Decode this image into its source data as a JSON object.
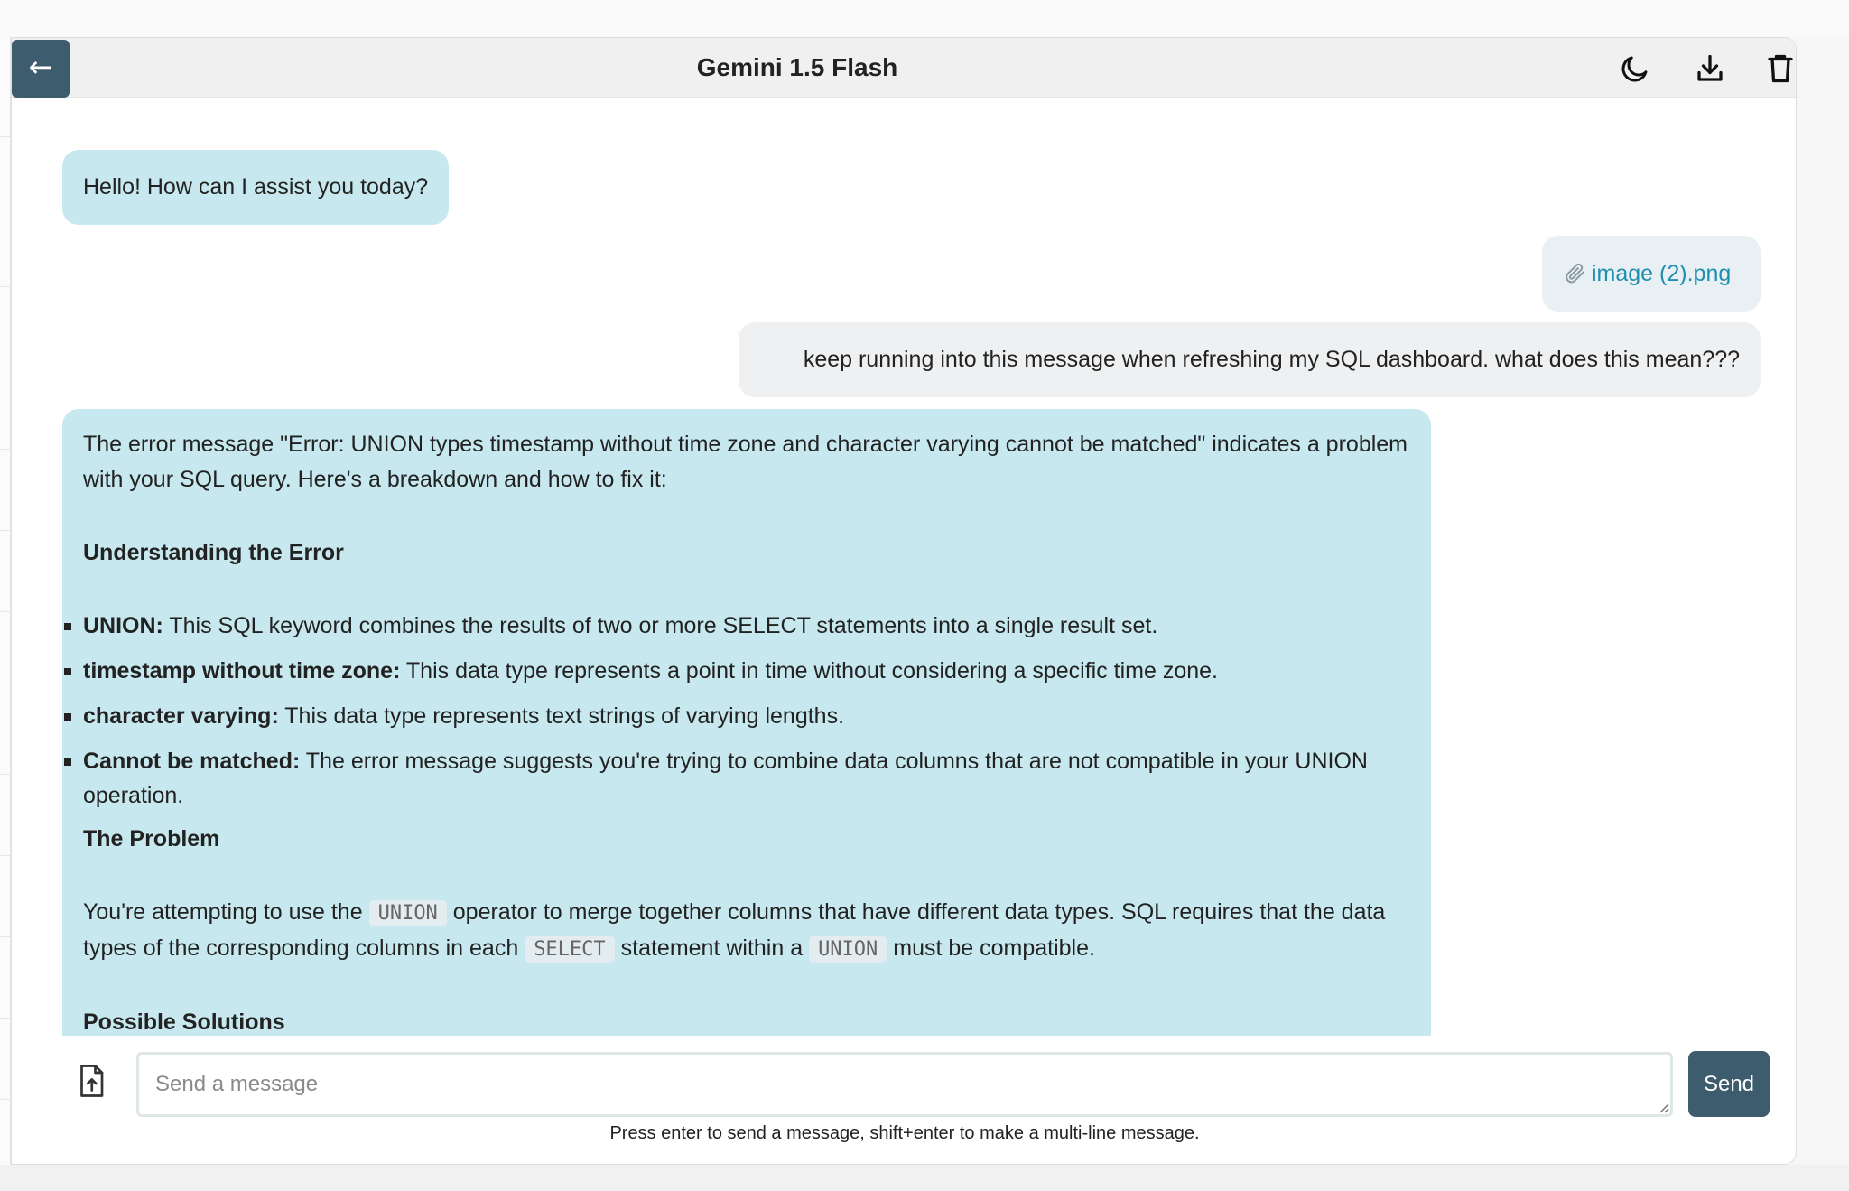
{
  "header": {
    "back_label": "←",
    "title": "Gemini 1.5 Flash",
    "icons": [
      "moon-icon",
      "download-icon",
      "trash-icon"
    ]
  },
  "messages": {
    "greeting": "Hello! How can I assist you today?",
    "attachment_name": "image (2).png",
    "user_question": "keep running into this message when refreshing my SQL dashboard. what does this mean???",
    "response": {
      "intro": "The error message \"Error: UNION types timestamp without time zone and character varying cannot be matched\" indicates a problem with your SQL query.  Here's a breakdown and how to fix it:",
      "heading_understanding": "Understanding the Error",
      "bullets": [
        {
          "term": "UNION:",
          "text": " This SQL keyword combines the results of two or more SELECT statements into a single result set."
        },
        {
          "term": "timestamp without time zone:",
          "text": " This data type represents a point in time without considering a specific time zone."
        },
        {
          "term": "character varying:",
          "text": " This data type represents text strings of varying lengths."
        },
        {
          "term": "Cannot be matched:",
          "text": " The error message suggests you're trying to combine data columns that are not compatible in your UNION operation."
        }
      ],
      "heading_problem": "The Problem",
      "problem_part1": "You're attempting to use the ",
      "code_union": "UNION",
      "problem_part2": " operator to merge together columns that have different data types.  SQL requires that the data types of the corresponding columns in each ",
      "code_select": "SELECT",
      "problem_part3": " statement within a ",
      "problem_part4": " must be compatible.",
      "heading_solutions": "Possible Solutions"
    }
  },
  "composer": {
    "placeholder": "Send a message",
    "send_label": "Send",
    "hint": "Press enter to send a message, shift+enter to make a multi-line message."
  },
  "colors": {
    "accent": "#3d5d6e",
    "bot_bubble": "#c6e8ee",
    "user_bubble": "#eef0f1",
    "attachment_link": "#1e8fb0"
  }
}
